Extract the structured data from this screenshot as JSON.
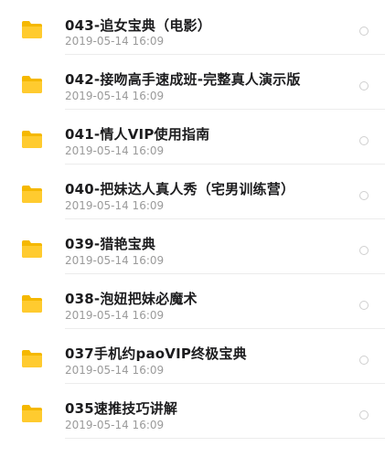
{
  "files": [
    {
      "name": "043-追女宝典（电影）",
      "date": "2019-05-14 16:09",
      "icon": "folder-icon"
    },
    {
      "name": "042-接吻高手速成班-完整真人演示版",
      "date": "2019-05-14 16:09",
      "icon": "folder-icon"
    },
    {
      "name": "041-情人VIP使用指南",
      "date": "2019-05-14 16:09",
      "icon": "folder-icon"
    },
    {
      "name": "040-把妹达人真人秀（宅男训练营）",
      "date": "2019-05-14 16:09",
      "icon": "folder-icon"
    },
    {
      "name": "039-猎艳宝典",
      "date": "2019-05-14 16:09",
      "icon": "folder-icon"
    },
    {
      "name": "038-泡妞把妹必魔术",
      "date": "2019-05-14 16:09",
      "icon": "folder-icon"
    },
    {
      "name": "037手机约paoVIP终极宝典",
      "date": "2019-05-14 16:09",
      "icon": "folder-icon"
    },
    {
      "name": "035速推技巧讲解",
      "date": "2019-05-14 16:09",
      "icon": "folder-icon"
    }
  ],
  "colors": {
    "folder": "#FFCB2F",
    "folder_tab": "#F5B800",
    "title_text": "#1C1C1E",
    "date_text": "#9B9B9B",
    "divider": "#ECECEC"
  }
}
